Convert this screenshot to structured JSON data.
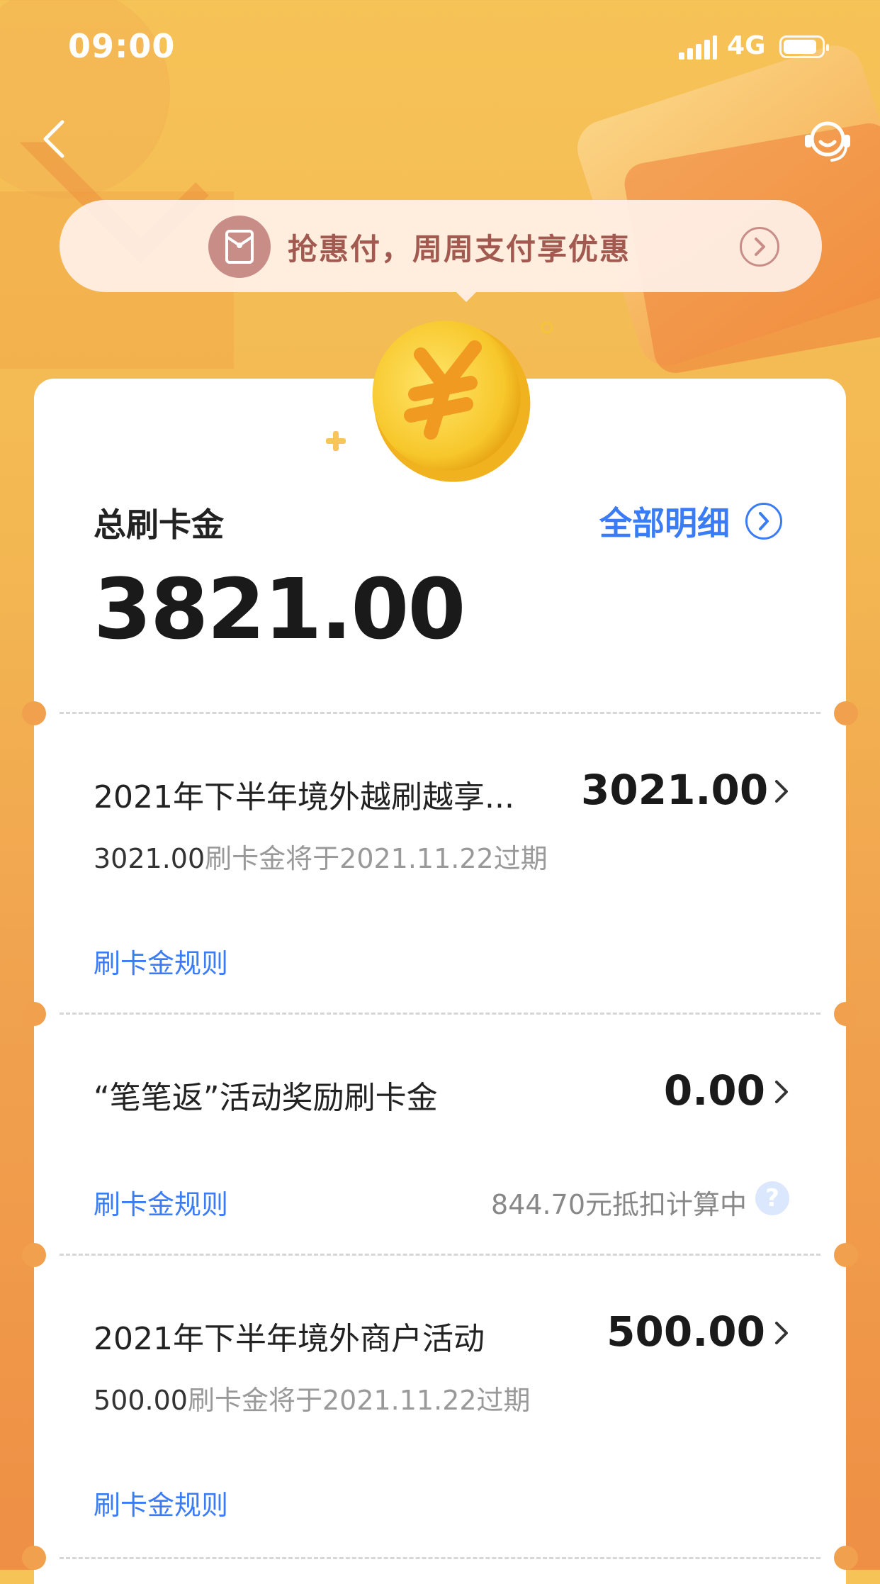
{
  "status_bar": {
    "time": "09:00",
    "network": "4G"
  },
  "promo": {
    "text": "抢惠付，周周支付享优惠"
  },
  "summary": {
    "label": "总刷卡金",
    "amount": "3821.00",
    "detail_link": "全部明细"
  },
  "items": [
    {
      "title": "2021年下半年境外越刷越享...",
      "amount": "3021.00",
      "sub_amount": "3021.00",
      "sub_text": "刷卡金将于2021.11.22过期",
      "rule_link": "刷卡金规则"
    },
    {
      "title": "“笔笔返”活动奖励刷卡金",
      "amount": "0.00",
      "rule_link": "刷卡金规则",
      "note": "844.70元抵扣计算中",
      "help": "?"
    },
    {
      "title": "2021年下半年境外商户活动",
      "amount": "500.00",
      "sub_amount": "500.00",
      "sub_text": "刷卡金将于2021.11.22过期",
      "rule_link": "刷卡金规则"
    }
  ],
  "colors": {
    "accent_blue": "#3a7bf6",
    "background_top": "#f6c357",
    "background_bottom": "#ee8f45",
    "promo_text": "#a25a50"
  },
  "icons": {
    "back": "chevron-left-icon",
    "support": "customer-service-icon",
    "promo": "red-envelope-icon",
    "coin": "yuan-coin-icon"
  }
}
